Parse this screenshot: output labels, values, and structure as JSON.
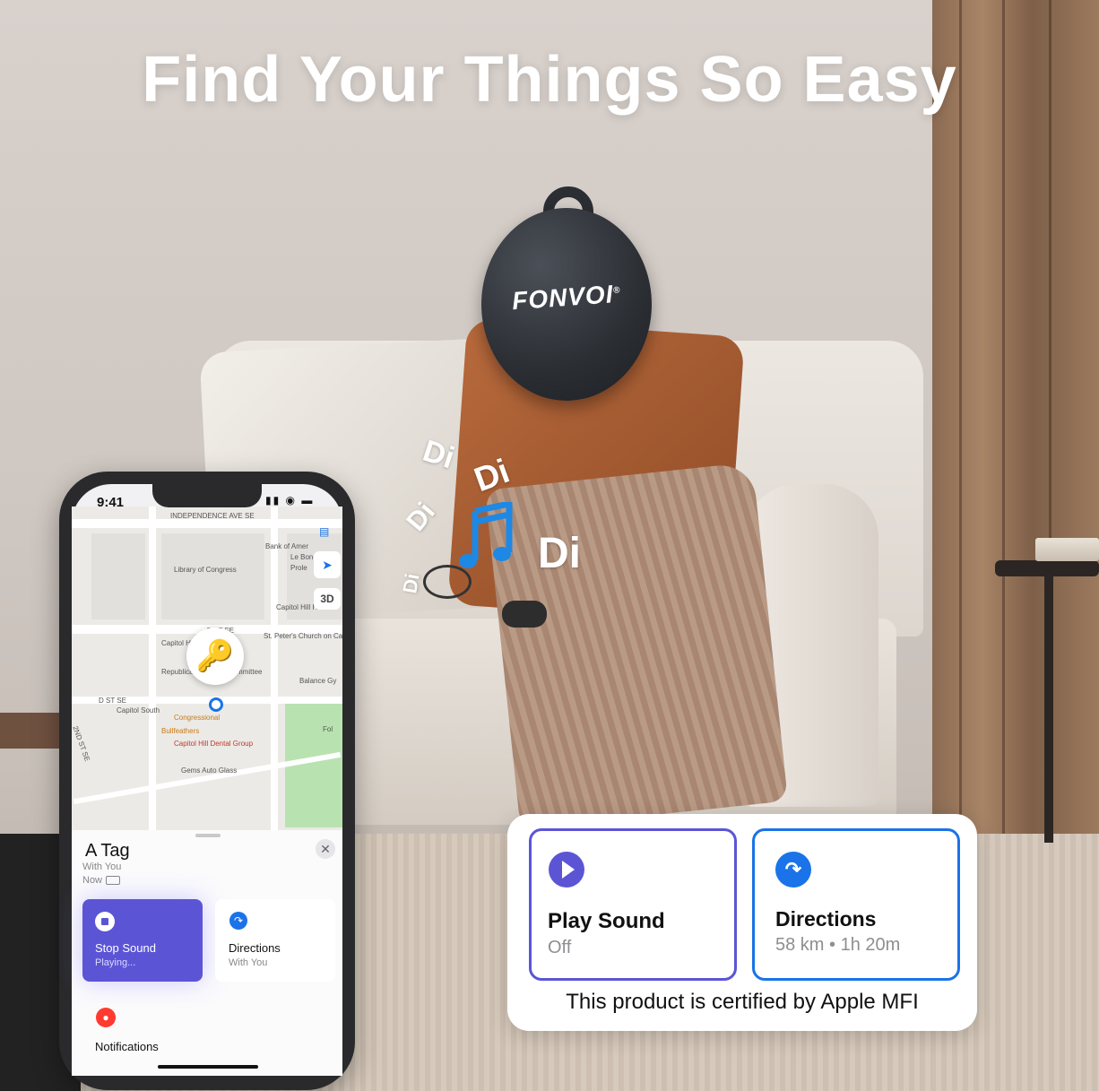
{
  "headline": "Find Your Things So Easy",
  "product": {
    "brand": "FONVOI",
    "registered_mark": "®"
  },
  "sound_effect": {
    "words": [
      "Di",
      "Di",
      "Di",
      "Di",
      "Di"
    ],
    "note_icon": "music-note-icon",
    "note_color": "#1e88e5"
  },
  "phone": {
    "status_bar": {
      "time": "9:41",
      "icons": [
        "location-arrow-icon",
        "signal-icon",
        "wifi-icon",
        "battery-icon"
      ]
    },
    "map": {
      "labels": [
        "INDEPENDENCE AVE SE",
        "Library of Congress",
        "Bank of Amer",
        "Le Bon",
        "Prole",
        "Capitol Hill Hotel",
        "Capitol Hill Club",
        "St. Peter's Church on Capitol Hill",
        "Republican National Committee",
        "Balance Gy",
        "D ST SE",
        "Capitol South",
        "Congressional",
        "Bullfeathers",
        "Capitol Hill Dental Group",
        "Gems Auto Glass",
        "Fol",
        "C ST SE",
        "2ND ST SE"
      ],
      "controls": {
        "three_d": "3D"
      }
    },
    "item_sheet": {
      "title": "A Tag",
      "subtitle_1": "With You",
      "subtitle_2": "Now",
      "actions": [
        {
          "label": "Stop Sound",
          "sub": "Playing...",
          "icon": "stop-icon",
          "color": "#5b55d6"
        },
        {
          "label": "Directions",
          "sub": "With You",
          "icon": "directions-arrow-icon",
          "color": "#1a73e8"
        }
      ],
      "notifications_label": "Notifications"
    }
  },
  "action_card": {
    "play_sound": {
      "label": "Play Sound",
      "sub": "Off",
      "icon": "play-icon",
      "color": "#5b55d6"
    },
    "directions": {
      "label": "Directions",
      "sub": "58 km • 1h 20m",
      "icon": "directions-arrow-icon",
      "color": "#1a73e8"
    },
    "certification": "This product is certified by Apple MFI"
  }
}
